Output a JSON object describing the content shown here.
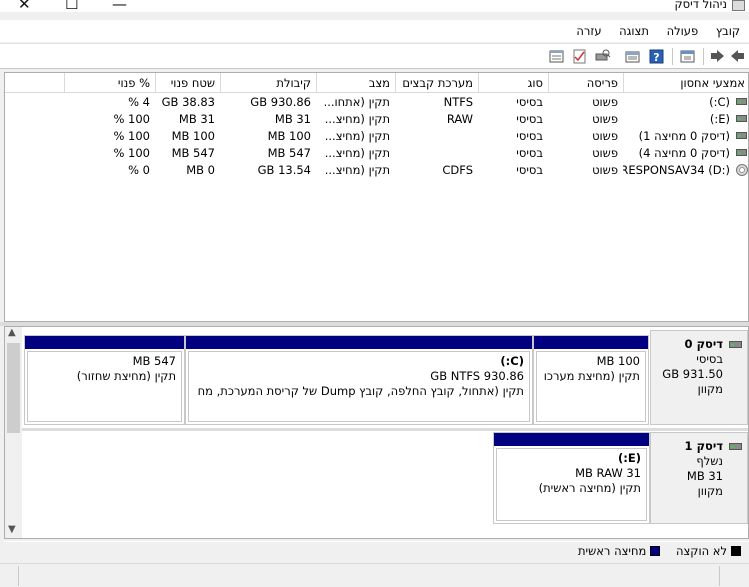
{
  "window": {
    "title": "ניהול דיסק",
    "icons": [
      "app-disk-icon",
      "close-icon",
      "maximize-icon",
      "minimize-icon"
    ]
  },
  "menu": [
    "קובץ",
    "פעולה",
    "תצוגה",
    "עזרה"
  ],
  "toolbar": {
    "icons": [
      "back-arrow-icon",
      "forward-arrow-icon",
      "properties-icon",
      "help-icon",
      "refresh-icon",
      "rescan-icon",
      "checklist-icon",
      "settings-icon"
    ]
  },
  "volume_table": {
    "headers": [
      "אמצעי אחסון",
      "פריסה",
      "סוג",
      "מערכת קבצים",
      "מצב",
      "קיבולת",
      "שטח פנוי",
      "% פנוי"
    ],
    "rows": [
      {
        "volume": "(C:)",
        "layout": "פשוט",
        "type": "בסיסי",
        "fs": "NTFS",
        "status": "תקין (אתחו...",
        "capacity": "930.86 GB",
        "free": "38.83 GB",
        "pct": "4 %",
        "icon": "drive-icon"
      },
      {
        "volume": "(E:)",
        "layout": "פשוט",
        "type": "בסיסי",
        "fs": "RAW",
        "status": "תקין (מחיצ...",
        "capacity": "31 MB",
        "free": "31 MB",
        "pct": "100 %",
        "icon": "drive-icon"
      },
      {
        "volume": "(דיסק 0 מחיצה 1)",
        "layout": "פשוט",
        "type": "בסיסי",
        "fs": "",
        "status": "תקין (מחיצ...",
        "capacity": "100 MB",
        "free": "100 MB",
        "pct": "100 %",
        "icon": "drive-icon"
      },
      {
        "volume": "(דיסק 0 מחיצה 4)",
        "layout": "פשוט",
        "type": "בסיסי",
        "fs": "",
        "status": "תקין (מחיצ...",
        "capacity": "547 MB",
        "free": "547 MB",
        "pct": "100 %",
        "icon": "drive-icon"
      },
      {
        "volume": "RESPONSAV34 (D:)",
        "layout": "פשוט",
        "type": "בסיסי",
        "fs": "CDFS",
        "status": "תקין (מחיצ...",
        "capacity": "13.54 GB",
        "free": "0 MB",
        "pct": "0 %",
        "icon": "cd-drive-icon"
      }
    ]
  },
  "disks": [
    {
      "title": "דיסק 0",
      "type": "בסיסי",
      "size": "931.50 GB",
      "state": "מקוון",
      "partitions": [
        {
          "name": "",
          "size": "100 MB",
          "status": "תקין (מחיצת מערכו"
        },
        {
          "name": "(C:)",
          "size": "930.86 GB NTFS",
          "status": "תקין (אתחול, קובץ החלפה, קובץ Dump של קריסת המערכת, מח"
        },
        {
          "name": "",
          "size": "547 MB",
          "status": "תקין (מחיצת שחזור)"
        }
      ]
    },
    {
      "title": "דיסק 1",
      "type": "נשלף",
      "size": "31 MB",
      "state": "מקוון",
      "partitions": [
        {
          "name": "(E:)",
          "size": "31 MB RAW",
          "status": "תקין (מחיצה ראשית)"
        }
      ]
    }
  ],
  "legend": [
    {
      "label": "לא הוקצה",
      "color": "#000000"
    },
    {
      "label": "מחיצה ראשית",
      "color": "#000080"
    }
  ]
}
